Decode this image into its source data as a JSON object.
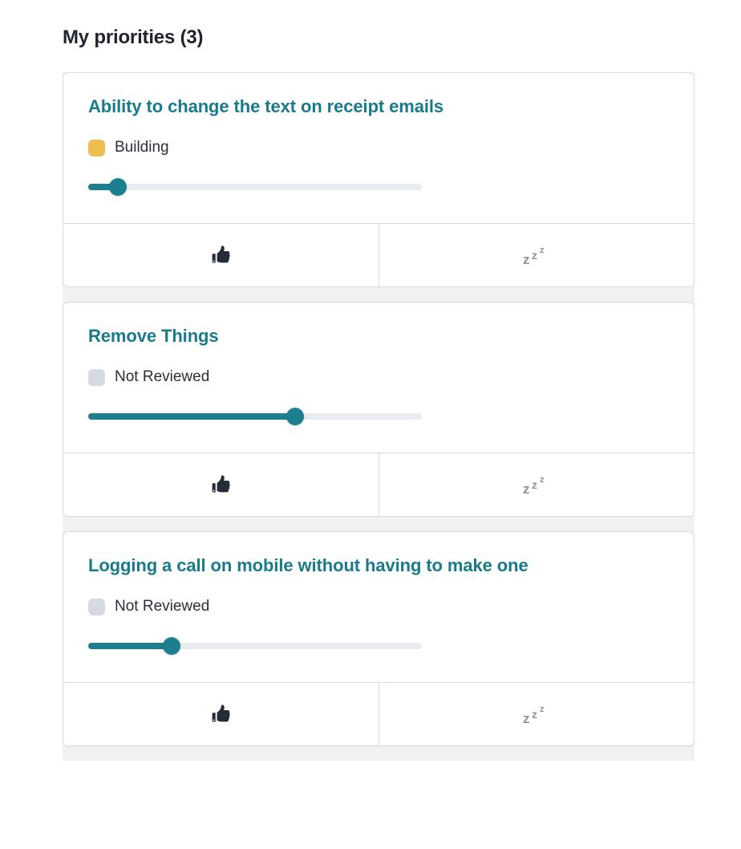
{
  "header": {
    "title": "My priorities (3)",
    "count": 3
  },
  "theme": {
    "accent_teal": "#197a8b",
    "slider_fill": "#1b7f90",
    "slider_track": "#e8ebef",
    "card_border": "#d5d9e2",
    "rail_background": "#f1f1f3",
    "status_building": "#efbe51",
    "status_not_reviewed": "#d6d9e0",
    "thumbsup_color": "#262b38",
    "snooze_color": "#8d93a3"
  },
  "actions": {
    "upvote_name": "thumbs-up-icon",
    "snooze_name": "snooze-icon",
    "snooze_glyph_1": "z",
    "snooze_glyph_2": "z",
    "snooze_glyph_3": "z"
  },
  "cards": [
    {
      "title": "Ability to change the text on receipt emails",
      "status_label": "Building",
      "status_color": "#efbe51",
      "slider_percent": 9
    },
    {
      "title": "Remove Things",
      "status_label": "Not Reviewed",
      "status_color": "#d6d9e0",
      "slider_percent": 62
    },
    {
      "title": "Logging a call on mobile without having to make one",
      "status_label": "Not Reviewed",
      "status_color": "#d6d9e0",
      "slider_percent": 25
    }
  ]
}
